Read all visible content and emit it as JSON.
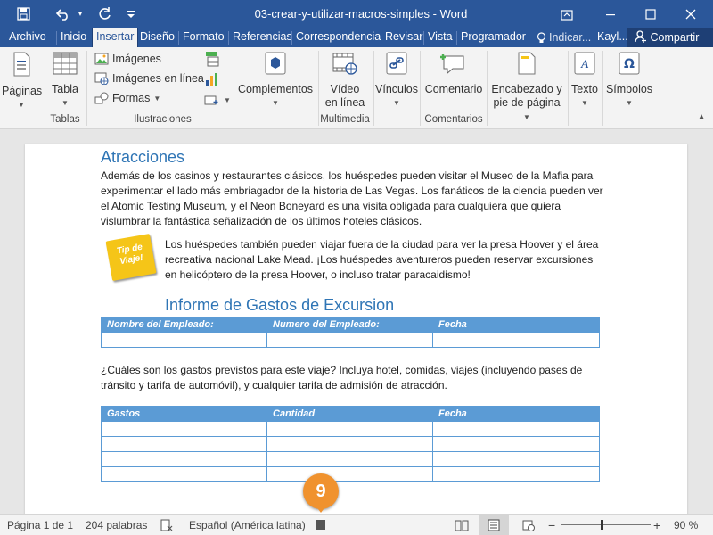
{
  "window": {
    "title": "03-crear-y-utilizar-macros-simples  -  Word",
    "icons": [
      "save-icon",
      "undo-icon",
      "redo-icon",
      "ribbon-display-icon",
      "minimize-icon",
      "maximize-icon",
      "close-icon"
    ]
  },
  "tabs": [
    "Archivo",
    "Inicio",
    "Insertar",
    "Diseño",
    "Formato",
    "Referencias",
    "Correspondencia",
    "Revisar",
    "Vista",
    "Programador"
  ],
  "active_tab": "Insertar",
  "tell_me": "Indicar...",
  "user": "Kayl...",
  "share": "Compartir",
  "ribbon": {
    "paginas": "Páginas",
    "tabla": "Tabla",
    "imagenes": "Imágenes",
    "imagenes_linea": "Imágenes en línea",
    "formas": "Formas",
    "complementos": "Complementos",
    "video_1": "Vídeo",
    "video_2": "en línea",
    "vinculos": "Vínculos",
    "comentario": "Comentario",
    "encabezado_1": "Encabezado y",
    "encabezado_2": "pie de página",
    "texto": "Texto",
    "simbolos": "Símbolos",
    "groups": {
      "tablas": "Tablas",
      "ilustraciones": "Ilustraciones",
      "multimedia": "Multimedia",
      "comentarios": "Comentarios"
    }
  },
  "document": {
    "heading1": "Atracciones",
    "para1": "Además de los casinos y restaurantes clásicos, los huéspedes pueden visitar el Museo de la Mafia para experimentar el lado más embriagador de la historia de Las Vegas. Los fanáticos de la ciencia pueden ver el Atomic Testing Museum, y el Neon Boneyard es una visita obligada para cualquiera que quiera vislumbrar la fantástica señalización de los últimos hoteles clásicos.",
    "tip_line1": "Tip de",
    "tip_line2": "Viaje!",
    "para2": "Los huéspedes también pueden viajar fuera de la ciudad para ver la presa Hoover y el área recreativa nacional Lake Mead. ¡Los huéspedes aventureros pueden reservar excursiones en helicóptero de la presa Hoover, o incluso tratar paracaidismo!",
    "heading2": "Informe de Gastos de Excursion",
    "table1_headers": [
      "Nombre del Empleado:",
      "Numero del Empleado:",
      "Fecha"
    ],
    "para3": "¿Cuáles son los gastos previstos para este viaje? Incluya hotel, comidas, viajes (incluyendo pases de tránsito y tarifa de automóvil), y cualquier tarifa de admisión de atracción.",
    "table2_headers": [
      "Gastos",
      "Cantidad",
      "Fecha"
    ]
  },
  "callout": "9",
  "status": {
    "page": "Página 1 de 1",
    "words": "204 palabras",
    "language": "Español (América latina)",
    "zoom": "90 %",
    "zoom_minus": "−",
    "zoom_plus": "+"
  },
  "colors": {
    "word_blue": "#2b579a",
    "heading_blue": "#2f75b5",
    "table_header": "#5b9bd5",
    "callout_orange": "#f0922e",
    "tip_yellow": "#f5c518"
  }
}
